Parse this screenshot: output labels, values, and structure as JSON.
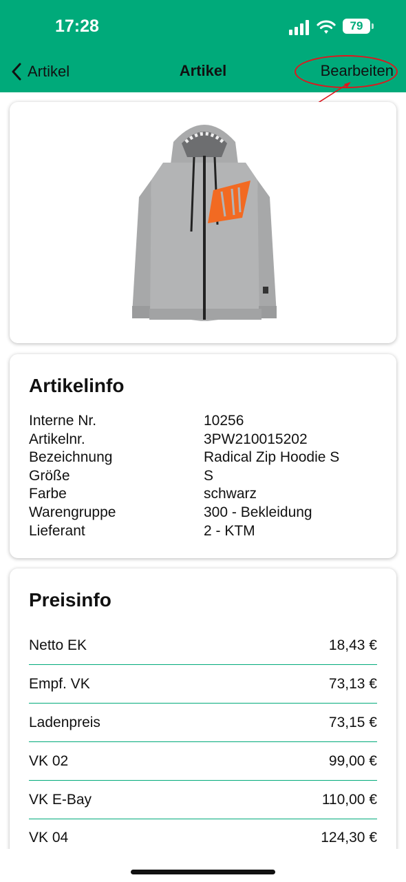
{
  "status": {
    "time": "17:28",
    "battery": "79"
  },
  "nav": {
    "back_label": "Artikel",
    "title": "Artikel",
    "edit_label": "Bearbeiten"
  },
  "colors": {
    "accent": "#00aa7a",
    "annotation": "#e3141c",
    "logo_orange": "#f26a22"
  },
  "product_image": {
    "icon": "hoodie-image"
  },
  "artikelinfo": {
    "title": "Artikelinfo",
    "rows": [
      {
        "label": "Interne Nr.",
        "value": "10256"
      },
      {
        "label": "Artikelnr.",
        "value": "3PW210015202"
      },
      {
        "label": "Bezeichnung",
        "value": "Radical Zip Hoodie S"
      },
      {
        "label": "Größe",
        "value": "S"
      },
      {
        "label": "Farbe",
        "value": "schwarz"
      },
      {
        "label": "Warengruppe",
        "value": "300 - Bekleidung"
      },
      {
        "label": "Lieferant",
        "value": "2 - KTM"
      }
    ]
  },
  "preisinfo": {
    "title": "Preisinfo",
    "rows": [
      {
        "label": "Netto EK",
        "value": "18,43 €"
      },
      {
        "label": "Empf. VK",
        "value": "73,13 €"
      },
      {
        "label": "Ladenpreis",
        "value": "73,15 €"
      },
      {
        "label": "VK 02",
        "value": "99,00 €"
      },
      {
        "label": "VK E-Bay",
        "value": "110,00 €"
      },
      {
        "label": "VK 04",
        "value": "124,30 €"
      }
    ]
  }
}
